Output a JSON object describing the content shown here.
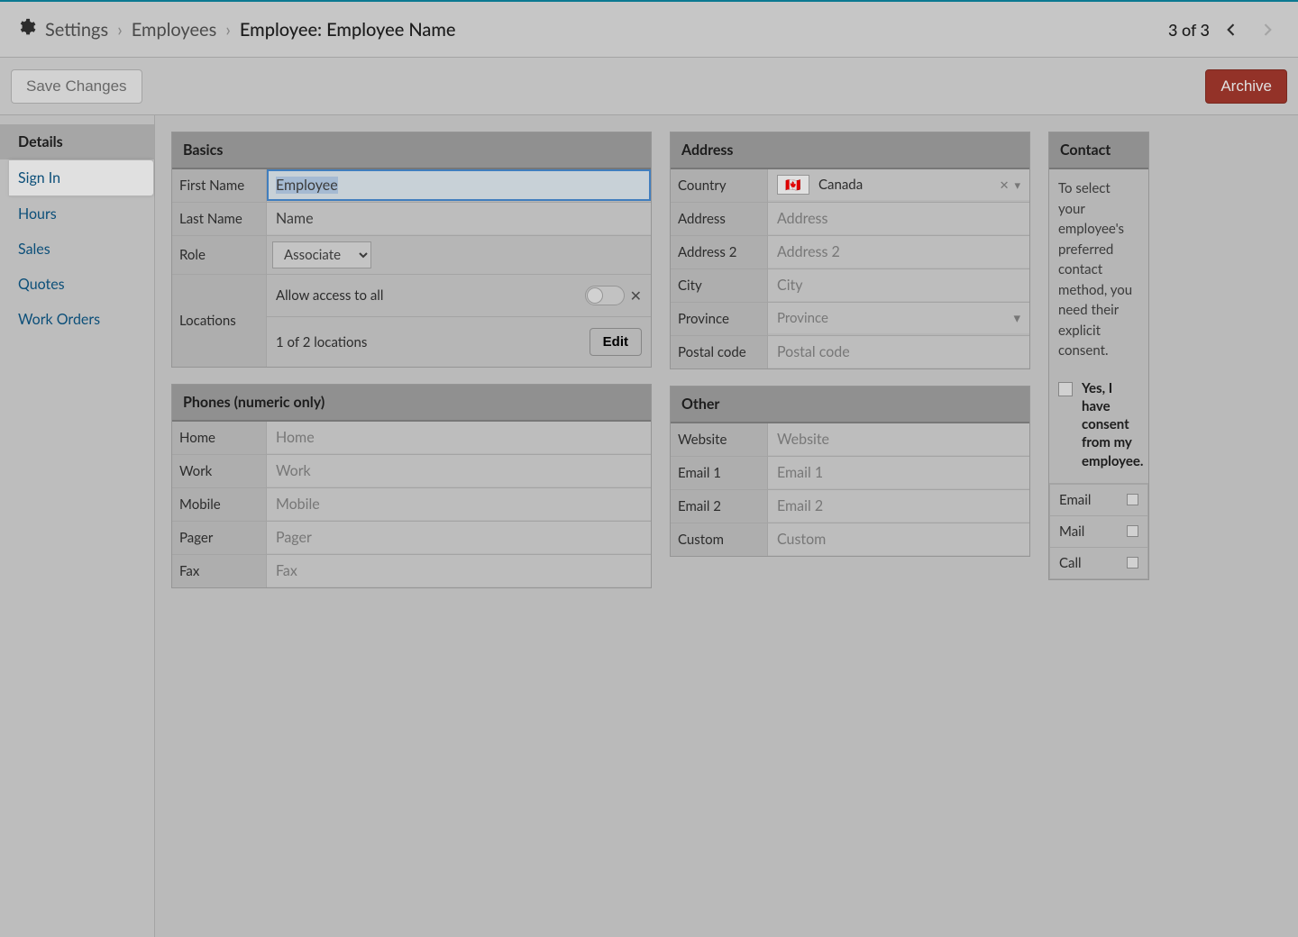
{
  "header": {
    "crumb1": "Settings",
    "crumb2": "Employees",
    "crumb3": "Employee: Employee Name",
    "pager": "3 of 3"
  },
  "actions": {
    "save": "Save Changes",
    "archive": "Archive"
  },
  "sidenav": {
    "details": "Details",
    "signin": "Sign In",
    "hours": "Hours",
    "sales": "Sales",
    "quotes": "Quotes",
    "workorders": "Work Orders"
  },
  "basics": {
    "title": "Basics",
    "labels": {
      "first": "First Name",
      "last": "Last Name",
      "role": "Role",
      "locations": "Locations"
    },
    "first": "Employee",
    "last": "Name",
    "role": "Associate",
    "allow_access": "Allow access to all",
    "locations_summary": "1 of 2 locations",
    "edit": "Edit"
  },
  "phones": {
    "title": "Phones (numeric only)",
    "rows": {
      "home": {
        "label": "Home",
        "ph": "Home"
      },
      "work": {
        "label": "Work",
        "ph": "Work"
      },
      "mobile": {
        "label": "Mobile",
        "ph": "Mobile"
      },
      "pager": {
        "label": "Pager",
        "ph": "Pager"
      },
      "fax": {
        "label": "Fax",
        "ph": "Fax"
      }
    }
  },
  "address": {
    "title": "Address",
    "labels": {
      "country": "Country",
      "address": "Address",
      "address2": "Address 2",
      "city": "City",
      "province": "Province",
      "postal": "Postal code"
    },
    "country": "Canada",
    "placeholders": {
      "address": "Address",
      "address2": "Address 2",
      "city": "City",
      "province": "Province",
      "postal": "Postal code"
    }
  },
  "other": {
    "title": "Other",
    "labels": {
      "website": "Website",
      "email1": "Email 1",
      "email2": "Email 2",
      "custom": "Custom"
    },
    "placeholders": {
      "website": "Website",
      "email1": "Email 1",
      "email2": "Email 2",
      "custom": "Custom"
    }
  },
  "contact": {
    "title": "Contact",
    "text": "To select your employee's preferred contact method, you need their explicit consent.",
    "consent": "Yes, I have consent from my employee.",
    "prefs": {
      "email": "Email",
      "mail": "Mail",
      "call": "Call"
    }
  }
}
